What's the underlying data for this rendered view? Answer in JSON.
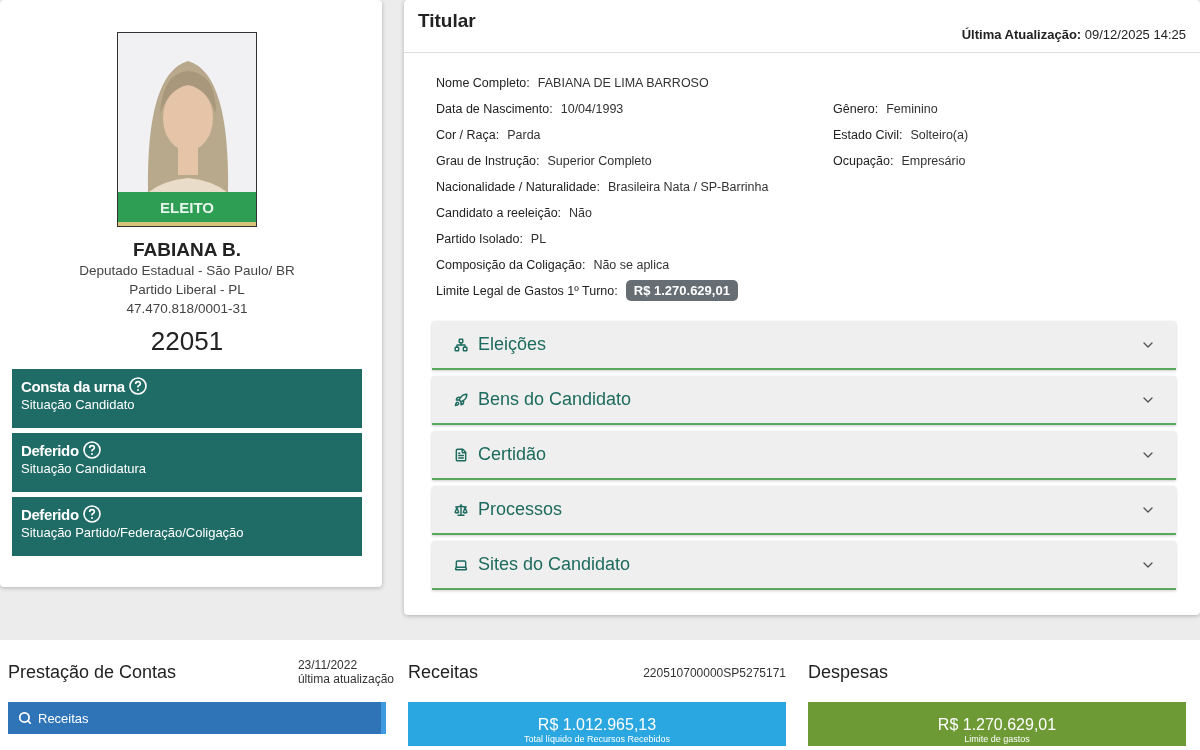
{
  "profile": {
    "badge": "ELEITO",
    "name": "FABIANA B.",
    "lines": [
      "Deputado Estadual - São Paulo/ BR",
      "Partido Liberal - PL",
      "47.470.818/0001-31"
    ],
    "number": "22051"
  },
  "statuses": [
    {
      "title": "Consta da urna",
      "subtitle": "Situação Candidato"
    },
    {
      "title": "Deferido",
      "subtitle": "Situação Candidatura"
    },
    {
      "title": "Deferido",
      "subtitle": "Situação Partido/Federação/Coligação"
    }
  ],
  "titular": {
    "title": "Titular",
    "updated_label": "Última Atualização:",
    "updated_value": "09/12/2025 14:25",
    "rows": [
      {
        "left": {
          "label": "Nome Completo:",
          "value": "FABIANA DE LIMA BARROSO",
          "kind": "text"
        }
      },
      {
        "left": {
          "label": "Data de Nascimento:",
          "value": "10/04/1993",
          "kind": "text"
        },
        "right": {
          "label": "Gênero:",
          "value": "Feminino",
          "kind": "text"
        }
      },
      {
        "left": {
          "label": "Cor / Raça:",
          "value": "Parda",
          "kind": "text"
        },
        "right": {
          "label": "Estado Civil:",
          "value": "Solteiro(a)",
          "kind": "text"
        }
      },
      {
        "left": {
          "label": "Grau de Instrução:",
          "value": "Superior Completo",
          "kind": "text"
        },
        "right": {
          "label": "Ocupação:",
          "value": "Empresário",
          "kind": "text"
        }
      },
      {
        "left": {
          "label": "Nacionalidade / Naturalidade:",
          "value": "Brasileira Nata / SP-Barrinha",
          "kind": "text"
        }
      },
      {
        "left": {
          "label": "Candidato a reeleição:",
          "value": "Não",
          "kind": "text"
        }
      },
      {
        "left": {
          "label": "Partido Isolado:",
          "value": "PL",
          "kind": "text"
        }
      },
      {
        "left": {
          "label": "Composição da Coligação:",
          "value": "Não se aplica",
          "kind": "text"
        }
      },
      {
        "left": {
          "label": "Limite Legal de Gastos 1º Turno:",
          "value": "R$ 1.270.629,01",
          "kind": "badge"
        }
      }
    ],
    "sections": [
      {
        "label": "Eleições",
        "expanded": false
      },
      {
        "label": "Bens do Candidato",
        "expanded": false
      },
      {
        "label": "Certidão",
        "expanded": false
      },
      {
        "label": "Processos",
        "expanded": false
      },
      {
        "label": "Sites do Candidato",
        "expanded": false
      }
    ]
  },
  "accounts": {
    "title": "Prestação de Contas",
    "date": "23/11/2022",
    "date_caption": "última atualização",
    "search_button": "Receitas"
  },
  "receitas": {
    "title": "Receitas",
    "code": "220510700000SP5275171",
    "amount": "R$ 1.012.965,13",
    "caption": "Total líquido de Recursos Recebidos"
  },
  "despesas": {
    "title": "Despesas",
    "amount": "R$ 1.270.629,01",
    "caption": "Limite de gastos"
  }
}
